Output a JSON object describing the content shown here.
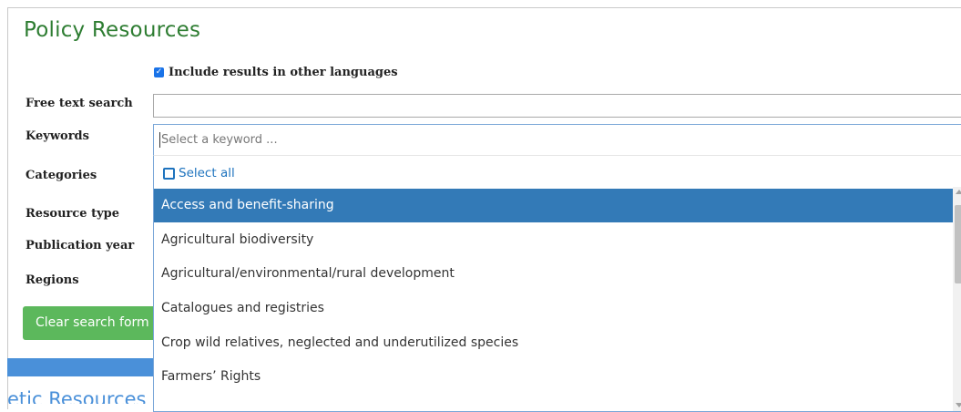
{
  "page": {
    "title": "Policy Resources",
    "include_languages_label": "Include results in other languages"
  },
  "filters": {
    "free_text_label": "Free text search",
    "keywords_label": "Keywords",
    "categories_label": "Categories",
    "resource_type_label": "Resource type",
    "publication_year_label": "Publication year",
    "regions_label": "Regions"
  },
  "keyword_dropdown": {
    "placeholder": "Select a keyword ...",
    "select_all": "Select all",
    "options": [
      {
        "label": "Access and benefit-sharing",
        "selected": true
      },
      {
        "label": "Agricultural biodiversity",
        "selected": false
      },
      {
        "label": "Agricultural/environmental/rural development",
        "selected": false
      },
      {
        "label": "Catalogues and registries",
        "selected": false
      },
      {
        "label": "Crop wild relatives, neglected and underutilized species",
        "selected": false
      },
      {
        "label": "Farmers’ Rights",
        "selected": false
      }
    ]
  },
  "buttons": {
    "clear": "Clear search form"
  },
  "partial": {
    "section_text": "etic Resources"
  },
  "colors": {
    "title_green": "#2e7d32",
    "selected_blue": "#337ab7",
    "button_green": "#5cb85c",
    "link_blue": "#1e73be"
  }
}
